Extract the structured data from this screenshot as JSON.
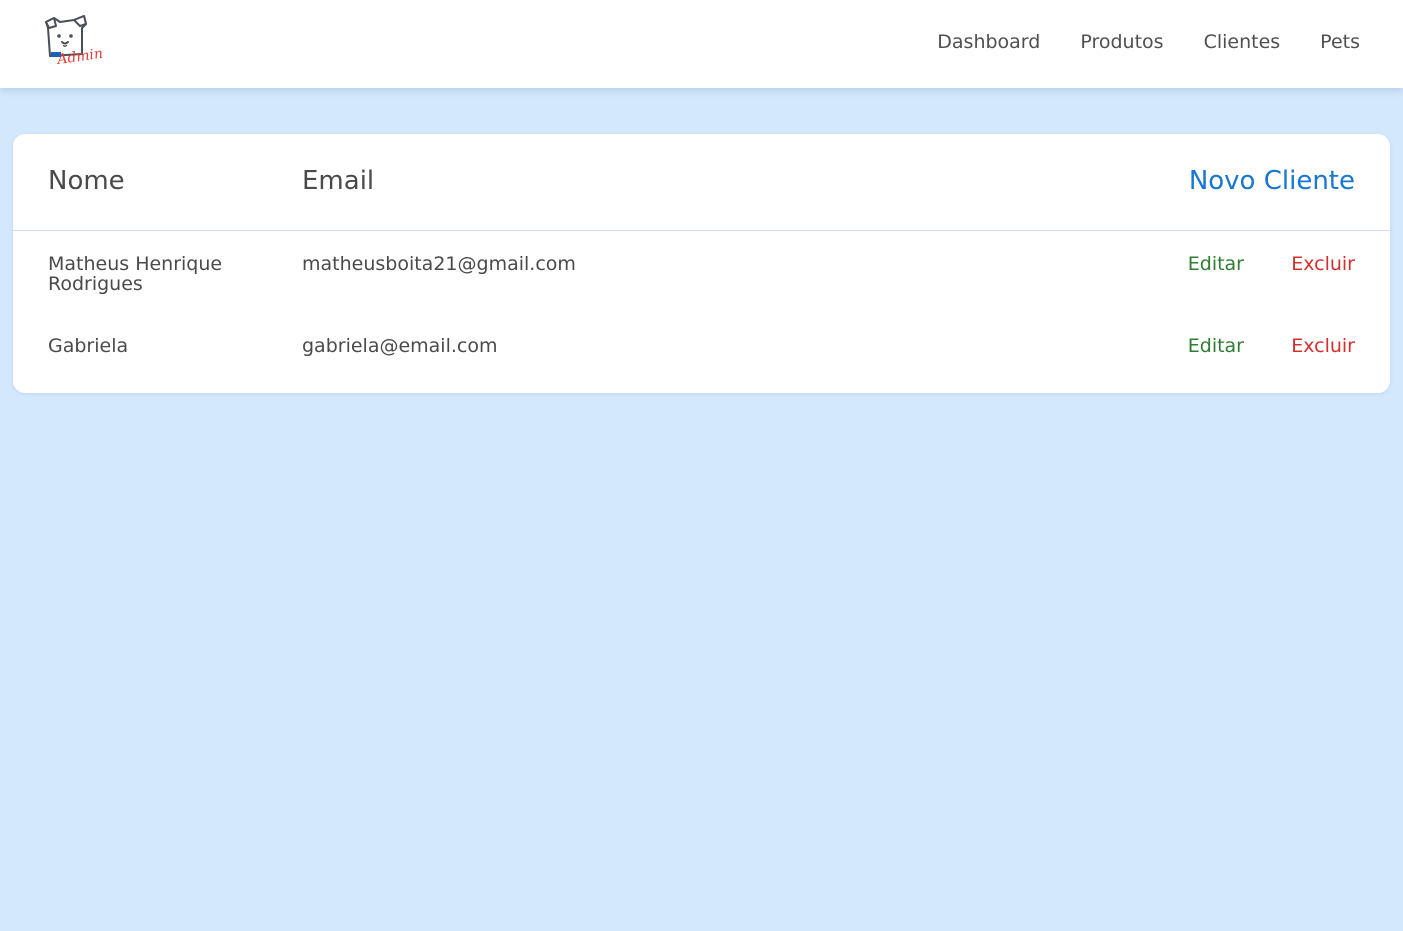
{
  "logo": {
    "icon": "dog-admin-logo",
    "text": "Admin",
    "text_color": "#e53935",
    "accent_color": "#1e5fb3"
  },
  "nav": {
    "items": [
      {
        "label": "Dashboard"
      },
      {
        "label": "Produtos"
      },
      {
        "label": "Clientes"
      },
      {
        "label": "Pets"
      }
    ]
  },
  "table": {
    "headers": {
      "nome": "Nome",
      "email": "Email"
    },
    "new_label": "Novo Cliente",
    "rows": [
      {
        "nome": "Matheus Henrique Rodrigues",
        "email": "matheusboita21@gmail.com",
        "edit": "Editar",
        "delete": "Excluir"
      },
      {
        "nome": "Gabriela",
        "email": "gabriela@email.com",
        "edit": "Editar",
        "delete": "Excluir"
      }
    ]
  },
  "colors": {
    "background": "#d4e8fd",
    "link_blue": "#1976d2",
    "edit_green": "#2e7d32",
    "delete_red": "#d32f2f"
  }
}
